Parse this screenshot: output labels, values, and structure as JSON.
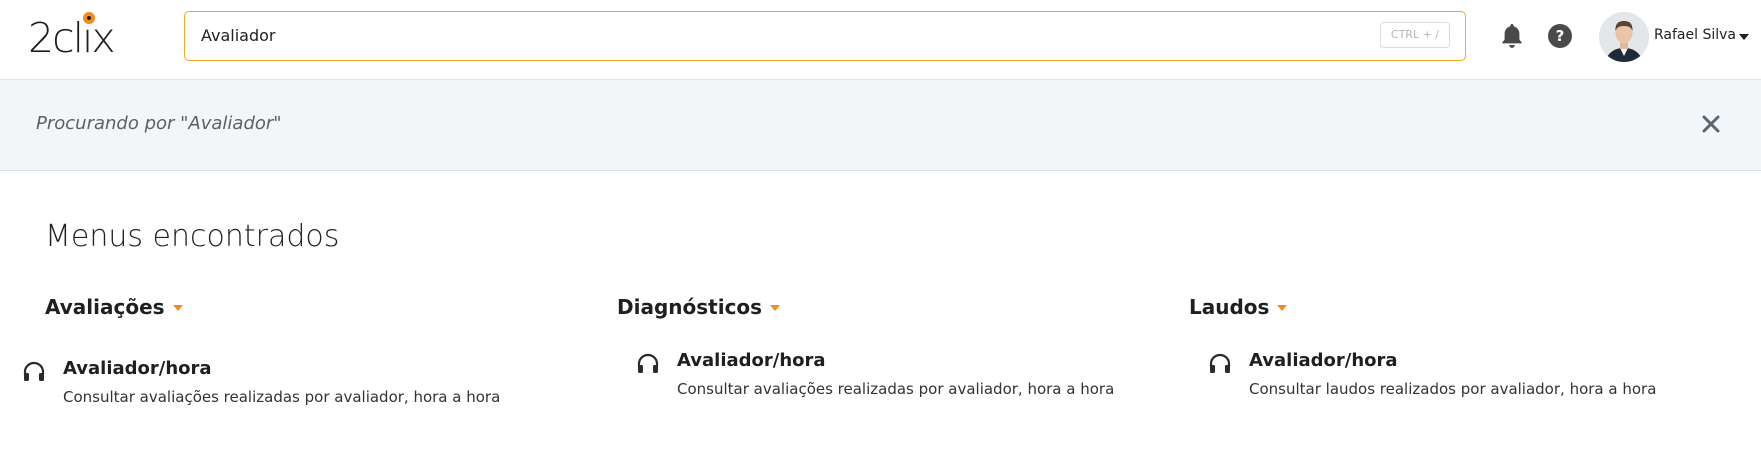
{
  "header": {
    "logo_text": "2clix",
    "search": {
      "value": "Avaliador",
      "shortcut": "CTRL + /"
    },
    "help_label": "?",
    "user": {
      "name": "Rafael Silva"
    }
  },
  "banner": {
    "text": "Procurando por \"Avaliador\""
  },
  "results": {
    "title": "Menus encontrados",
    "columns": [
      {
        "heading": "Avaliações",
        "items": [
          {
            "title": "Avaliador/hora",
            "description": "Consultar avaliações realizadas por avaliador, hora a hora",
            "icon": "headset-icon"
          }
        ]
      },
      {
        "heading": "Diagnósticos",
        "items": [
          {
            "title": "Avaliador/hora",
            "description": "Consultar avaliações realizadas por avaliador, hora a hora",
            "icon": "headset-icon"
          }
        ]
      },
      {
        "heading": "Laudos",
        "items": [
          {
            "title": "Avaliador/hora",
            "description": "Consultar laudos realizados por avaliador, hora a hora",
            "icon": "headset-icon"
          }
        ]
      }
    ]
  },
  "colors": {
    "accent": "#f28c1e",
    "search_border": "#f5a623",
    "banner_bg": "#f3f6f9"
  }
}
